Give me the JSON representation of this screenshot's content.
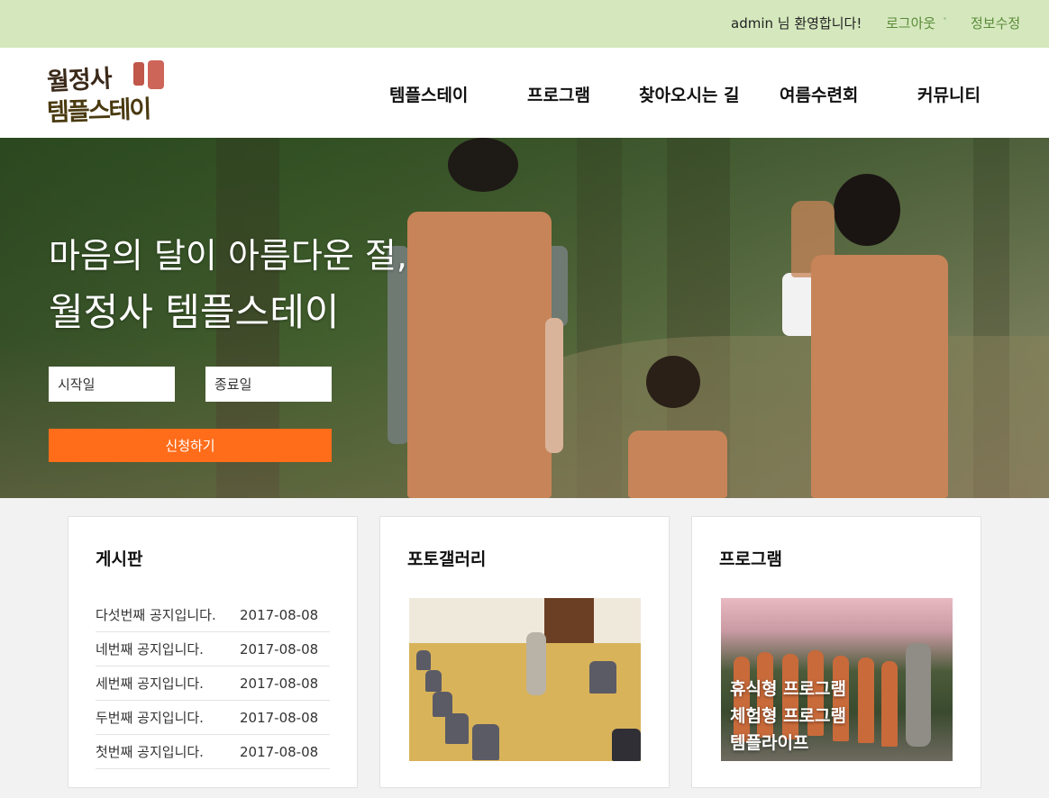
{
  "topbar": {
    "welcome": "admin 님 환영합니다!",
    "logout": "로그아웃",
    "edit_profile": "정보수정"
  },
  "logo": {
    "line1": "월정사",
    "line2": "템플스테이"
  },
  "nav": {
    "items": [
      "템플스테이",
      "프로그램",
      "찾아오시는 길",
      "여름수련회",
      "커뮤니티"
    ]
  },
  "hero": {
    "tagline": "마음의 달이 아름다운 절,",
    "title": "월정사 템플스테이",
    "start_placeholder": "시작일",
    "end_placeholder": "종료일",
    "apply_label": "신청하기"
  },
  "board": {
    "title": "게시판",
    "posts": [
      {
        "title": "다섯번째 공지입니다.",
        "date": "2017-08-08"
      },
      {
        "title": "네번째 공지입니다.",
        "date": "2017-08-08"
      },
      {
        "title": "세번째 공지입니다.",
        "date": "2017-08-08"
      },
      {
        "title": "두번째 공지입니다.",
        "date": "2017-08-08"
      },
      {
        "title": "첫번째 공지입니다.",
        "date": "2017-08-08"
      }
    ]
  },
  "gallery": {
    "title": "포토갤러리"
  },
  "program": {
    "title": "프로그램",
    "items": [
      "휴식형 프로그램",
      "체험형 프로그램",
      "템플라이프"
    ]
  },
  "colors": {
    "topbar_bg": "#d5e8bd",
    "accent_orange": "#ff6d1b",
    "link_green": "#5a8a3a"
  }
}
